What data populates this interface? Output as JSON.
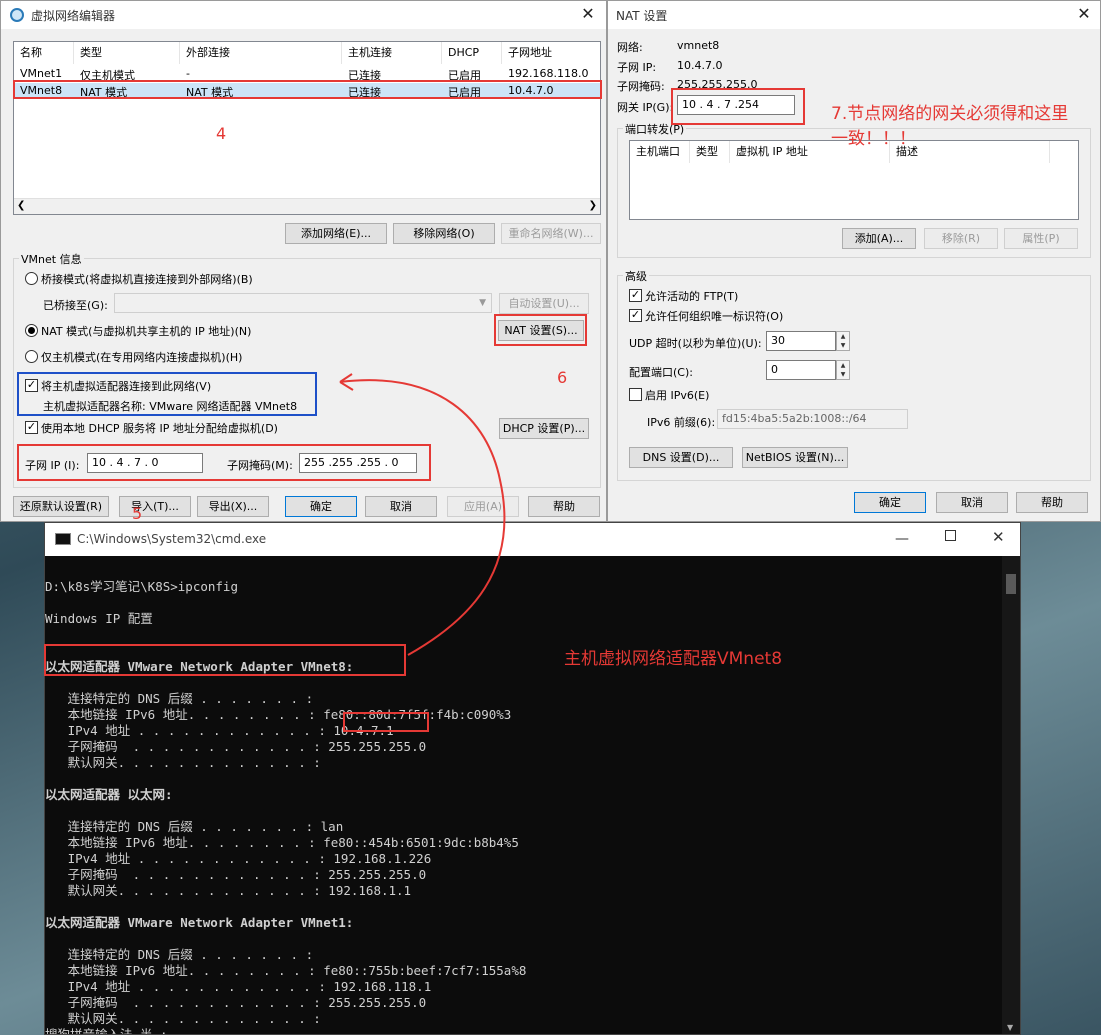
{
  "vne": {
    "title": "虚拟网络编辑器",
    "columns": [
      "名称",
      "类型",
      "外部连接",
      "主机连接",
      "DHCP",
      "子网地址"
    ],
    "rows": [
      [
        "VMnet1",
        "仅主机模式",
        "-",
        "已连接",
        "已启用",
        "192.168.118.0"
      ],
      [
        "VMnet8",
        "NAT 模式",
        "NAT 模式",
        "已连接",
        "已启用",
        "10.4.7.0"
      ]
    ],
    "btn_add_network": "添加网络(E)...",
    "btn_remove_network": "移除网络(O)",
    "btn_rename_network": "重命名网络(W)...",
    "info_title": "VMnet 信息",
    "radio_bridged": "桥接模式(将虚拟机直接连接到外部网络)(B)",
    "bridged_to_label": "已桥接至(G):",
    "btn_auto_settings": "自动设置(U)...",
    "radio_nat": "NAT 模式(与虚拟机共享主机的 IP 地址)(N)",
    "btn_nat_settings": "NAT 设置(S)...",
    "radio_hostonly": "仅主机模式(在专用网络内连接虚拟机)(H)",
    "chk_connect_adapter": "将主机虚拟适配器连接到此网络(V)",
    "adapter_name": "主机虚拟适配器名称: VMware 网络适配器 VMnet8",
    "chk_dhcp": "使用本地 DHCP 服务将 IP 地址分配给虚拟机(D)",
    "btn_dhcp_settings": "DHCP 设置(P)...",
    "subnet_ip_label": "子网 IP (I):",
    "subnet_ip_value": "10 . 4 . 7 . 0",
    "subnet_mask_label": "子网掩码(M):",
    "subnet_mask_value": "255 .255 .255 . 0",
    "btn_restore": "还原默认设置(R)",
    "btn_import": "导入(T)...",
    "btn_export": "导出(X)...",
    "btn_ok": "确定",
    "btn_cancel": "取消",
    "btn_apply": "应用(A)",
    "btn_help": "帮助"
  },
  "nat": {
    "title": "NAT 设置",
    "network_label": "网络:",
    "network_value": "vmnet8",
    "subnet_ip_label": "子网 IP:",
    "subnet_ip_value": "10.4.7.0",
    "subnet_mask_label": "子网掩码:",
    "subnet_mask_value": "255.255.255.0",
    "gateway_label": "网关 IP(G):",
    "gateway_value": "10 . 4 . 7 .254",
    "pf_title": "端口转发(P)",
    "pf_columns": [
      "主机端口",
      "类型",
      "虚拟机 IP 地址",
      "描述"
    ],
    "btn_add": "添加(A)...",
    "btn_remove": "移除(R)",
    "btn_props": "属性(P)",
    "adv_title": "高级",
    "chk_ftp": "允许活动的 FTP(T)",
    "chk_oui": "允许任何组织唯一标识符(O)",
    "udp_label": "UDP 超时(以秒为单位)(U):",
    "udp_value": "30",
    "config_port_label": "配置端口(C):",
    "config_port_value": "0",
    "chk_ipv6": "启用 IPv6(E)",
    "ipv6_prefix_label": "IPv6 前缀(6):",
    "ipv6_prefix_value": "fd15:4ba5:5a2b:1008::/64",
    "btn_dns": "DNS 设置(D)...",
    "btn_netbios": "NetBIOS 设置(N)...",
    "btn_ok": "确定",
    "btn_cancel": "取消",
    "btn_help": "帮助"
  },
  "cmd": {
    "title": "C:\\Windows\\System32\\cmd.exe",
    "lines": [
      "",
      "D:\\k8s学习笔记\\K8S>ipconfig",
      "",
      "Windows IP 配置",
      "",
      "",
      "以太网适配器 VMware Network Adapter VMnet8:",
      "",
      "   连接特定的 DNS 后缀 . . . . . . . :",
      "   本地链接 IPv6 地址. . . . . . . . : fe80::80d:7f5f:f4b:c090%3",
      "   IPv4 地址 . . . . . . . . . . . . : 10.4.7.1",
      "   子网掩码  . . . . . . . . . . . . : 255.255.255.0",
      "   默认网关. . . . . . . . . . . . . :",
      "",
      "以太网适配器 以太网:",
      "",
      "   连接特定的 DNS 后缀 . . . . . . . : lan",
      "   本地链接 IPv6 地址. . . . . . . . : fe80::454b:6501:9dc:b8b4%5",
      "   IPv4 地址 . . . . . . . . . . . . : 192.168.1.226",
      "   子网掩码  . . . . . . . . . . . . : 255.255.255.0",
      "   默认网关. . . . . . . . . . . . . : 192.168.1.1",
      "",
      "以太网适配器 VMware Network Adapter VMnet1:",
      "",
      "   连接特定的 DNS 后缀 . . . . . . . :",
      "   本地链接 IPv6 地址. . . . . . . . : fe80::755b:beef:7cf7:155a%8",
      "   IPv4 地址 . . . . . . . . . . . . : 192.168.118.1",
      "   子网掩码  . . . . . . . . . . . . : 255.255.255.0",
      "   默认网关. . . . . . . . . . . . . :",
      "搜狗拼音输入法 半 :"
    ]
  },
  "annotations": {
    "n4": "4",
    "n6": "6",
    "n5": "5",
    "gateway_note_1": "7.节点网络的网关必须得和这里",
    "gateway_note_2": "一致！！！",
    "vmnet8_note": "主机虚拟网络适配器VMnet8"
  },
  "colors": {
    "annotation_red": "#e53935",
    "annotation_blue": "#1e50c8",
    "cmd_bg": "#0c0c0c"
  }
}
